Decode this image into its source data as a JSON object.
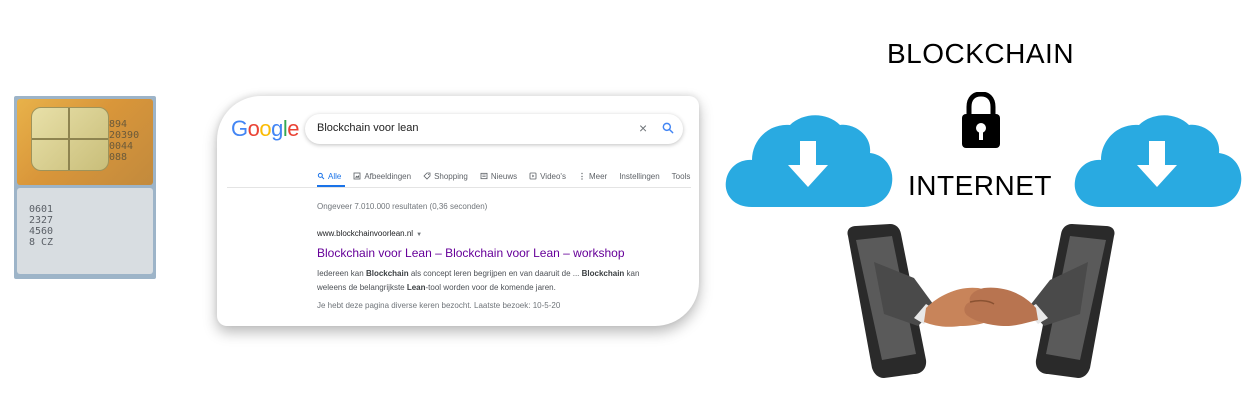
{
  "sim": {
    "top_numbers": "894\n20390\n0044\n088",
    "bottom_numbers": "0601\n2327\n4560\n8 CZ"
  },
  "google": {
    "logo": [
      "G",
      "o",
      "o",
      "g",
      "l",
      "e"
    ],
    "query": "Blockchain voor lean",
    "clear_icon": "×",
    "tabs": [
      {
        "label": "Alle",
        "icon": "search-icon"
      },
      {
        "label": "Afbeeldingen",
        "icon": "image-icon"
      },
      {
        "label": "Shopping",
        "icon": "tag-icon"
      },
      {
        "label": "Nieuws",
        "icon": "news-icon"
      },
      {
        "label": "Video's",
        "icon": "play-icon"
      },
      {
        "label": "Meer",
        "icon": "more-icon"
      },
      {
        "label": "Instellingen",
        "icon": ""
      },
      {
        "label": "Tools",
        "icon": ""
      }
    ],
    "stats": "Ongeveer 7.010.000 resultaten (0,36 seconden)",
    "result": {
      "url": "www.blockchainvoorlean.nl",
      "url_arrow": "▼",
      "title": "Blockchain voor Lean – Blockchain voor Lean – workshop",
      "snippet_line1_a": "Iedereen kan ",
      "snippet_line1_b": "Blockchain",
      "snippet_line1_c": " als concept leren begrijpen en van daaruit de ... ",
      "snippet_line1_d": "Blockchain",
      "snippet_line1_e": " kan",
      "snippet_line2_a": "weleens de belangrijkste ",
      "snippet_line2_b": "Lean",
      "snippet_line2_c": "-tool worden voor de komende jaren.",
      "visited": "Je hebt deze pagina diverse keren bezocht. Laatste bezoek: 10-5-20"
    }
  },
  "labels": {
    "blockchain": "BLOCKCHAIN",
    "internet": "INTERNET"
  },
  "colors": {
    "cloud": "#29aae1",
    "google_blue": "#4285f4",
    "google_red": "#ea4335",
    "google_yellow": "#fbbc05",
    "google_green": "#34a853",
    "visited_link": "#660099"
  }
}
